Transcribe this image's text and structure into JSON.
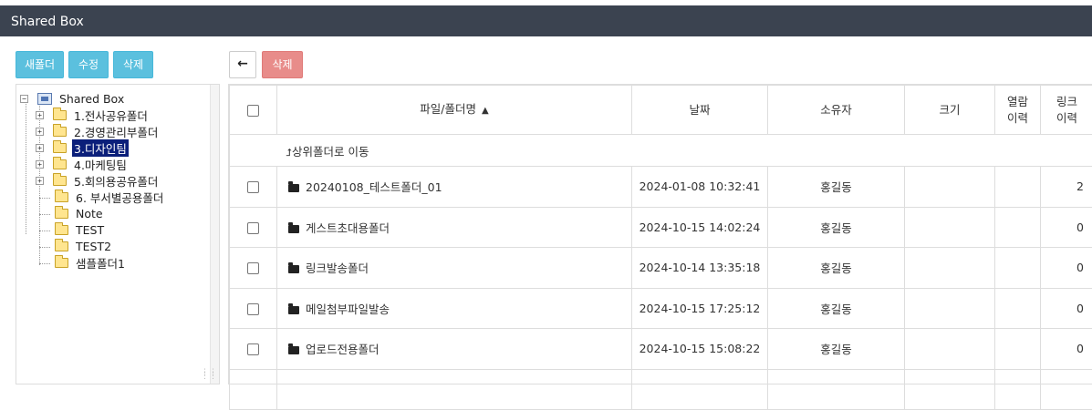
{
  "app": {
    "title": "Shared Box"
  },
  "toolbar_left": {
    "new_folder": "새폴더",
    "edit": "수정",
    "delete": "삭제"
  },
  "toolbar_right": {
    "back_glyph": "🡐",
    "delete": "삭제"
  },
  "tree": {
    "root": "Shared Box",
    "items": [
      {
        "label": "1.전사공유폴더",
        "expandable": true,
        "expander": "+"
      },
      {
        "label": "2.경영관리부폴더",
        "expandable": true,
        "expander": "+"
      },
      {
        "label": "3.디자인팀",
        "expandable": true,
        "expander": "+",
        "selected": true
      },
      {
        "label": "4.마케팅팀",
        "expandable": true,
        "expander": "+"
      },
      {
        "label": "5.회의용공유폴더",
        "expandable": true,
        "expander": "+"
      },
      {
        "label": "6. 부서별공용폴더",
        "expandable": false
      },
      {
        "label": "Note",
        "expandable": false
      },
      {
        "label": "TEST",
        "expandable": false
      },
      {
        "label": "TEST2",
        "expandable": false
      },
      {
        "label": "샘플폴더1",
        "expandable": false
      }
    ]
  },
  "table": {
    "headers": {
      "name": "파일/폴더명",
      "sort_indicator": "▲",
      "date": "날짜",
      "owner": "소유자",
      "size": "크기",
      "view_history_1": "열람",
      "view_history_2": "이력",
      "link_history_1": "링크",
      "link_history_2": "이력"
    },
    "up_row": {
      "icon": "⮥",
      "label": "상위폴더로 이동"
    },
    "rows": [
      {
        "name": "20240108_테스트폴더_01",
        "date": "2024-01-08 10:32:41",
        "owner": "홍길동",
        "size": "",
        "views": "",
        "links": "2",
        "links_is_link": true
      },
      {
        "name": "게스트초대용폴더",
        "date": "2024-10-15 14:02:24",
        "owner": "홍길동",
        "size": "",
        "views": "",
        "links": "0"
      },
      {
        "name": "링크발송폴더",
        "date": "2024-10-14 13:35:18",
        "owner": "홍길동",
        "size": "",
        "views": "",
        "links": "0"
      },
      {
        "name": "메일첨부파일발송",
        "date": "2024-10-15 17:25:12",
        "owner": "홍길동",
        "size": "",
        "views": "",
        "links": "0"
      },
      {
        "name": "업로드전용폴더",
        "date": "2024-10-15 15:08:22",
        "owner": "홍길동",
        "size": "",
        "views": "",
        "links": "0"
      }
    ]
  },
  "colors": {
    "titlebar": "#3b4350",
    "info_button": "#5bc0de",
    "danger_button": "#e88c8a",
    "selection": "#0b1f7a",
    "link": "#337ab7"
  }
}
